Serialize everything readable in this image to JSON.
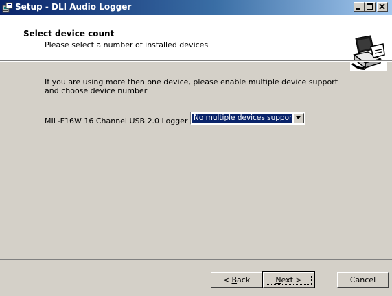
{
  "window": {
    "title": "Setup - DLI Audio Logger",
    "icon": "setup-installer-icon",
    "controls": [
      "minimize-icon",
      "maximize-icon",
      "close-icon"
    ]
  },
  "header": {
    "title": "Select device count",
    "subtitle": "Please select a number of installed devices",
    "logo_icon": "computer-setup-icon"
  },
  "content": {
    "description": "If you are using more then one device, please enable multiple device support and choose device number",
    "device_label": "MIL-F16W 16 Channel USB 2.0 Logger",
    "device_select": {
      "value": "No multiple devices support",
      "icon": "dropdown-arrow-icon"
    }
  },
  "buttons": {
    "back": {
      "prefix": "< ",
      "accel": "B",
      "rest": "ack"
    },
    "next": {
      "accel": "N",
      "rest": "ext >"
    },
    "cancel": "Cancel"
  },
  "colors": {
    "dialog_face": "#d4d0c8",
    "titlebar_start": "#0a246a",
    "titlebar_end": "#a6caf0",
    "selection": "#0a246a"
  }
}
